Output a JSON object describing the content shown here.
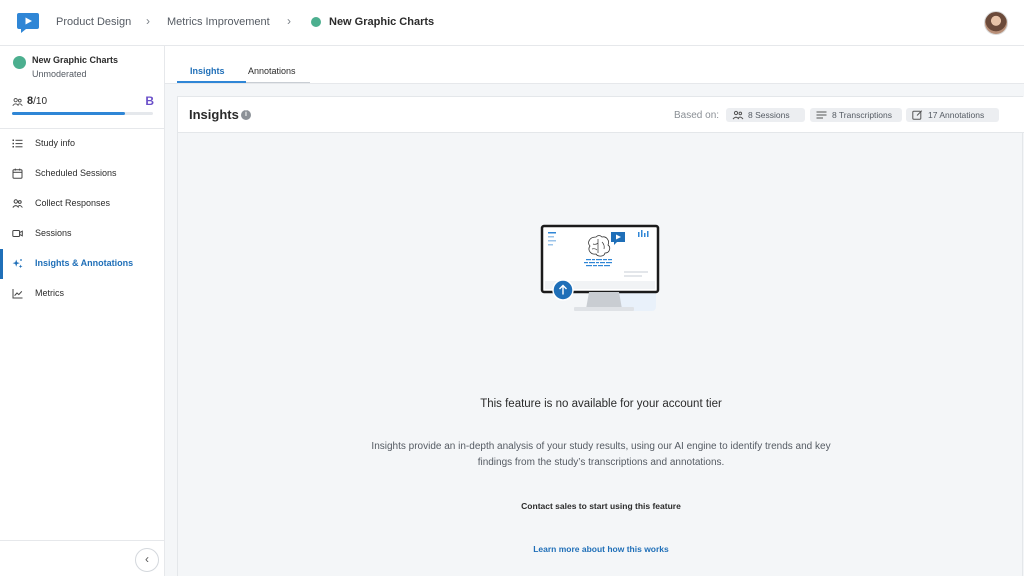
{
  "breadcrumb": {
    "items": [
      "Product Design",
      "Metrics Improvement",
      "New Graphic Charts"
    ],
    "separator": "›"
  },
  "study": {
    "title": "New Graphic Charts",
    "subtitle": "Unmoderated",
    "count_done": "8",
    "count_total": "/10",
    "progress_fraction": 0.8,
    "tier_badge": "B"
  },
  "sidebar": {
    "items": [
      {
        "label": "Study info",
        "icon": "list-icon"
      },
      {
        "label": "Scheduled Sessions",
        "icon": "calendar-icon"
      },
      {
        "label": "Collect Responses",
        "icon": "people-icon"
      },
      {
        "label": "Sessions",
        "icon": "video-icon"
      },
      {
        "label": "Insights & Annotations",
        "icon": "sparkle-icon"
      },
      {
        "label": "Metrics",
        "icon": "line-chart-icon"
      }
    ],
    "active_index": 4,
    "collapse_glyph": "‹"
  },
  "tabs": [
    "Insights",
    "Annotations"
  ],
  "insights": {
    "title": "Insights",
    "info_glyph": "i",
    "based_on_label": "Based on:",
    "pills": [
      "8 Sessions",
      "8 Transcriptions",
      "17 Annotations"
    ],
    "message_title": "This feature is no available for your account tier",
    "message_body": "Insights provide an in-depth analysis of your study results, using our AI engine to identify trends and key findings from the study’s transcriptions and annotations.",
    "contact": "Contact sales to start using this feature",
    "learn_more": "Learn more about how this works"
  },
  "colors": {
    "accent": "#2f86d6",
    "active_nav": "#1f6fb8",
    "status_green": "#4caf8f",
    "badge_purple": "#6a4fc9"
  }
}
